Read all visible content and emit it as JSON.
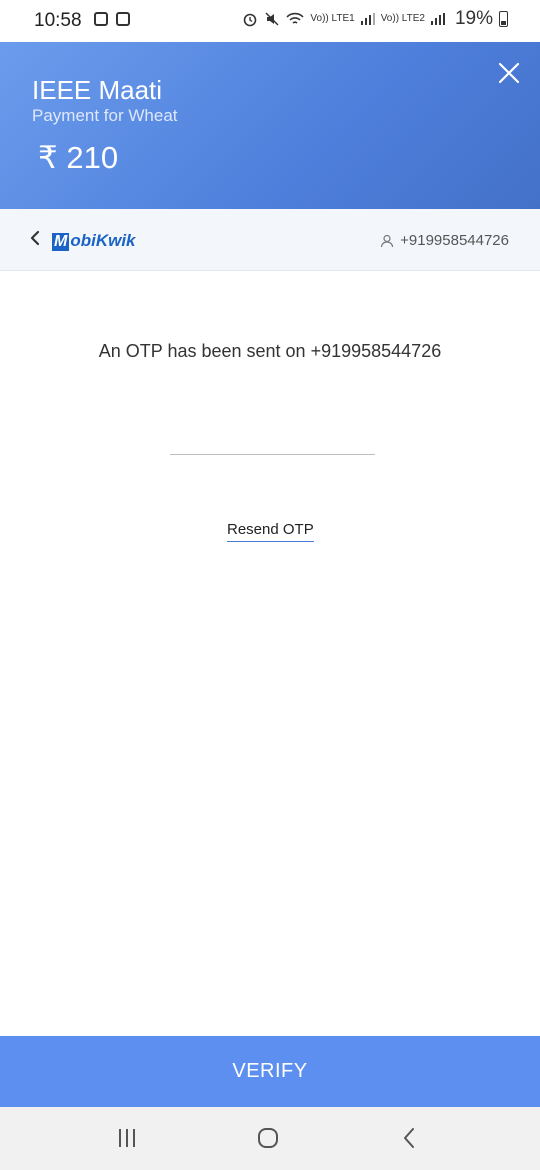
{
  "status_bar": {
    "time": "10:58",
    "battery": "19%",
    "sim1": "Vo)) LTE1",
    "sim2": "Vo)) LTE2"
  },
  "payment": {
    "merchant": "IEEE Maati",
    "description": "Payment for Wheat",
    "amount": "₹ 210"
  },
  "provider": {
    "logo_initial": "M",
    "logo_rest": "obiKwik",
    "phone": "+919958544726"
  },
  "otp": {
    "message": "An OTP has been sent on +919958544726",
    "input_value": "",
    "resend_label": "Resend OTP"
  },
  "actions": {
    "verify_label": "VERIFY"
  },
  "colors": {
    "header": "#4d7fdc",
    "verify": "#5c8ff0",
    "provider_bg": "#f3f7fc",
    "link_underline": "#4a78d6"
  }
}
